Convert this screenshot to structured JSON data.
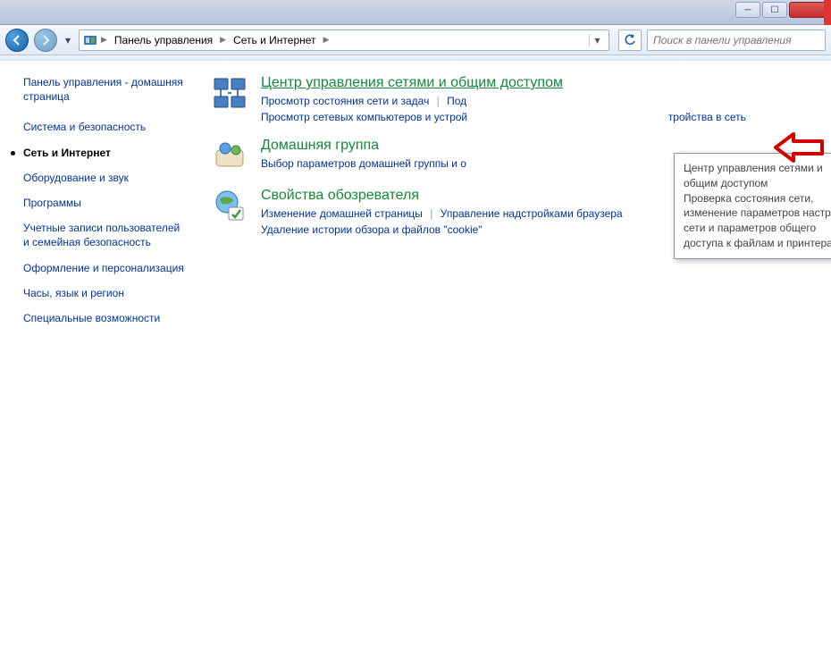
{
  "breadcrumb": {
    "root": "Панель управления",
    "level1": "Сеть и Интернет"
  },
  "search": {
    "placeholder": "Поиск в панели управления"
  },
  "sidebar": {
    "home": "Панель управления - домашняя страница",
    "items": [
      {
        "label": "Система и безопасность"
      },
      {
        "label": "Сеть и Интернет"
      },
      {
        "label": "Оборудование и звук"
      },
      {
        "label": "Программы"
      },
      {
        "label": "Учетные записи пользователей и семейная безопасность"
      },
      {
        "label": "Оформление и персонализация"
      },
      {
        "label": "Часы, язык и регион"
      },
      {
        "label": "Специальные возможности"
      }
    ]
  },
  "categories": {
    "network": {
      "title": "Центр управления сетями и общим доступом",
      "link1": "Просмотр состояния сети и задач",
      "link2_prefix": "Под",
      "link3": "Просмотр сетевых компьютеров и устрой",
      "link3_suffix": "тройства в сеть"
    },
    "homegroup": {
      "title": "Домашняя группа",
      "link1": "Выбор параметров домашней группы и о"
    },
    "internet": {
      "title": "Свойства обозревателя",
      "link1": "Изменение домашней страницы",
      "link2": "Управление надстройками браузера",
      "link3": "Удаление истории обзора и файлов \"cookie\""
    }
  },
  "tooltip": {
    "title": "Центр управления сетями и общим доступом",
    "body": "Проверка состояния сети, изменение параметров настройки сети и параметров общего доступа к файлам и принтерам."
  }
}
